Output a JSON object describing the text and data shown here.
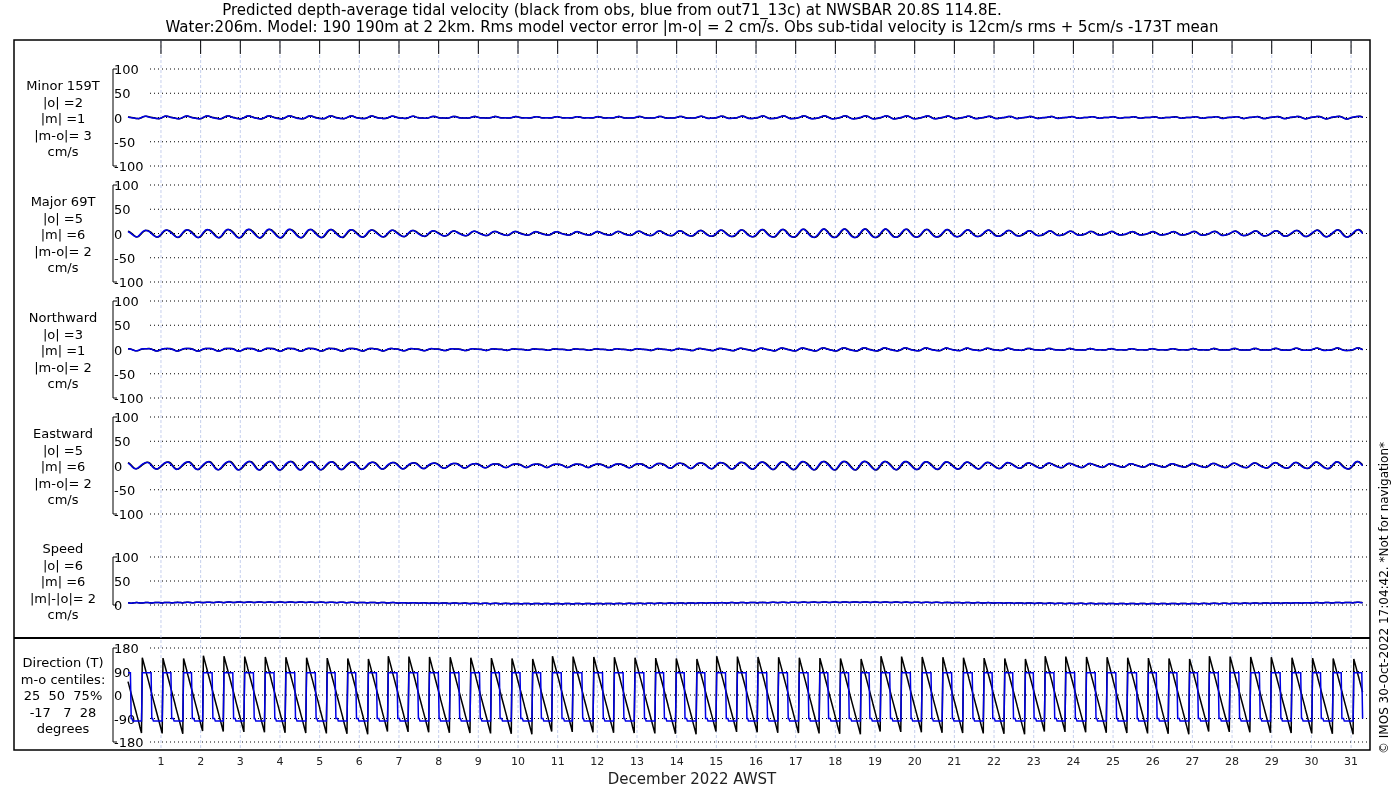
{
  "title_lines": [
    "Predicted depth-average tidal velocity (black from obs, blue from out71_13c) at NWSBAR 20.8S 114.8E.",
    "Water:206m. Model: 190 190m at 2 2km. Rms model vector error |m-o| = 2 cm/s. Obs sub-tidal velocity is 12cm/s rms + 5cm/s -173T mean"
  ],
  "panels": [
    {
      "kind": "velocity",
      "label_lines": [
        "Minor 159T",
        "|o| =2",
        "|m| =1",
        "|m-o|= 3",
        "cm/s"
      ],
      "yticks": [
        "100",
        "50",
        "0",
        "-50",
        "-100"
      ]
    },
    {
      "kind": "velocity",
      "label_lines": [
        "Major 69T",
        "|o| =5",
        "|m| =6",
        "|m-o|= 2",
        "cm/s"
      ],
      "yticks": [
        "100",
        "50",
        "0",
        "-50",
        "-100"
      ]
    },
    {
      "kind": "velocity",
      "label_lines": [
        "Northward",
        "|o| =3",
        "|m| =1",
        "|m-o|= 2",
        "cm/s"
      ],
      "yticks": [
        "100",
        "50",
        "0",
        "-50",
        "-100"
      ]
    },
    {
      "kind": "velocity",
      "label_lines": [
        "Eastward",
        "|o| =5",
        "|m| =6",
        "|m-o|= 2",
        "cm/s"
      ],
      "yticks": [
        "100",
        "50",
        "0",
        "-50",
        "-100"
      ]
    },
    {
      "kind": "speed",
      "label_lines": [
        "Speed",
        "|o| =6",
        "|m| =6",
        "|m|-|o|= 2",
        "cm/s"
      ],
      "yticks": [
        "100",
        "50",
        "0"
      ]
    },
    {
      "kind": "direction",
      "label_lines": [
        "Direction (T)",
        "m-o centiles:",
        "25  50  75%",
        "-17   7  28",
        "degrees"
      ],
      "yticks": [
        "180",
        "90",
        "0",
        "-90",
        "-180"
      ]
    }
  ],
  "xticks": [
    "1",
    "2",
    "3",
    "4",
    "5",
    "6",
    "7",
    "8",
    "9",
    "10",
    "11",
    "12",
    "13",
    "14",
    "15",
    "16",
    "17",
    "18",
    "19",
    "20",
    "21",
    "22",
    "23",
    "24",
    "25",
    "26",
    "27",
    "28",
    "29",
    "30",
    "31"
  ],
  "xlabel": "December 2022 AWST",
  "copyright": "© IMOS 30-Oct-2022 17:04:42. *Not for navigation*"
}
